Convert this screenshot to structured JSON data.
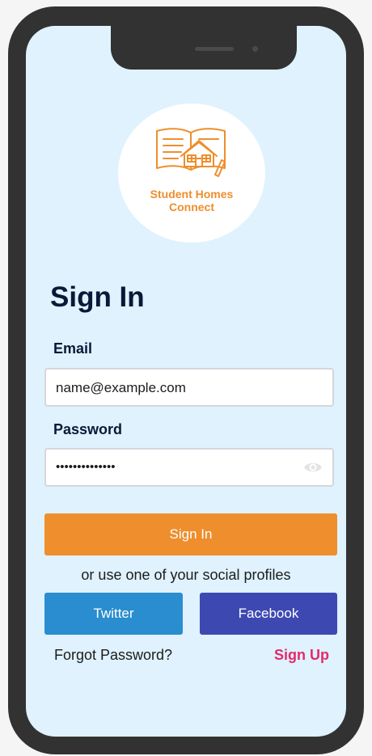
{
  "logo": {
    "text": "Student Homes\nConnect",
    "icon": "book-house-icon"
  },
  "form": {
    "title": "Sign In",
    "email_label": "Email",
    "email_value": "name@example.com",
    "password_label": "Password",
    "password_value": "••••••••••••••",
    "password_toggle_icon": "eye-icon"
  },
  "buttons": {
    "sign_in": "Sign In",
    "twitter": "Twitter",
    "facebook": "Facebook"
  },
  "social_text": "or use one of your social profiles",
  "links": {
    "forgot_password": "Forgot Password?",
    "sign_up": "Sign Up"
  },
  "colors": {
    "accent_orange": "#ee8e2d",
    "twitter_blue": "#2a8dcf",
    "facebook_indigo": "#3d49b1",
    "signup_pink": "#e5296b",
    "screen_background": "#dff2fd",
    "title_navy": "#0c1838"
  }
}
